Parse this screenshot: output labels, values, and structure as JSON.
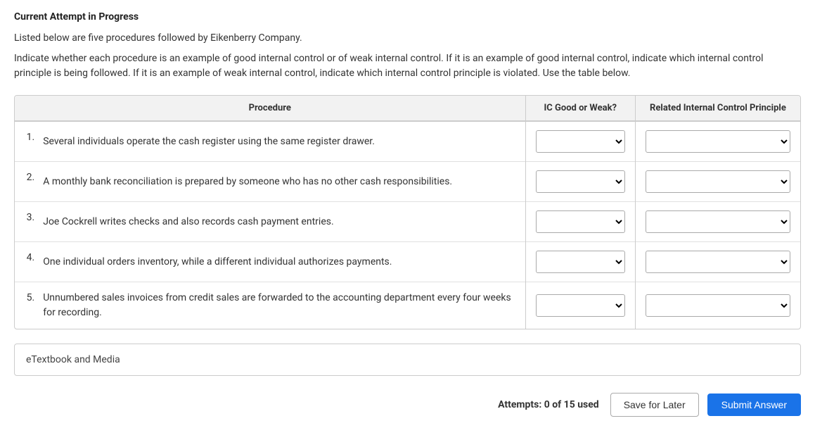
{
  "header": {
    "title": "Current Attempt in Progress"
  },
  "instructions": {
    "line1": "Listed below are five procedures followed by Eikenberry Company.",
    "line2": "Indicate whether each procedure is an example of good internal control or of weak internal control. If it is an example of good internal control, indicate which internal control principle is being followed. If it is an example of weak internal control, indicate which internal control principle is violated. Use the table below."
  },
  "table": {
    "columns": {
      "procedure": "Procedure",
      "ic": "IC Good or Weak?",
      "principle": "Related Internal Control Principle"
    },
    "rows": [
      {
        "num": "1.",
        "procedure": "Several individuals operate the cash register using the same register drawer."
      },
      {
        "num": "2.",
        "procedure": "A monthly bank reconciliation is prepared by someone who has no other cash responsibilities."
      },
      {
        "num": "3.",
        "procedure": "Joe Cockrell writes checks and also records cash payment entries."
      },
      {
        "num": "4.",
        "procedure": "One individual orders inventory, while a different individual authorizes payments."
      },
      {
        "num": "5.",
        "procedure": "Unnumbered sales invoices from credit sales are forwarded to the accounting department every four weeks for recording."
      }
    ]
  },
  "etextbook": {
    "label": "eTextbook and Media"
  },
  "footer": {
    "attempts_label": "Attempts: 0 of 15 used",
    "save_label": "Save for Later",
    "submit_label": "Submit Answer"
  }
}
